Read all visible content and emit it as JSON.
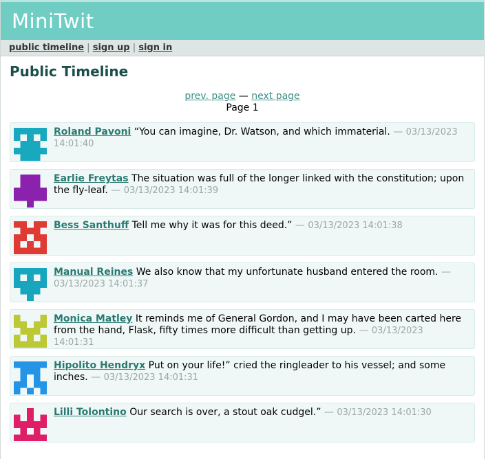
{
  "header": {
    "title": "MiniTwit"
  },
  "nav": {
    "public_timeline": "public timeline",
    "sep1": "|",
    "sign_up": "sign up",
    "sep2": "|",
    "sign_in": "sign in"
  },
  "main": {
    "title": "Public Timeline",
    "pagination": {
      "prev": "prev. page",
      "separator": "—",
      "next": "next page",
      "page_label": "Page 1"
    }
  },
  "messages": [
    {
      "user": "Roland Pavoni",
      "text": "“You can imagine, Dr. Watson, and which immaterial.",
      "dash": "—",
      "timestamp": "03/13/2023 14:01:40",
      "color": "#19a9bf"
    },
    {
      "user": "Earlie Freytas",
      "text": "The situation was full of the longer linked with the constitution; upon the fly-leaf.",
      "dash": "—",
      "timestamp": "03/13/2023 14:01:39",
      "color": "#8a22ad"
    },
    {
      "user": "Bess Santhuff",
      "text": "Tell me why it was for this deed.”",
      "dash": "—",
      "timestamp": "03/13/2023 14:01:38",
      "color": "#e03a35"
    },
    {
      "user": "Manual Reines",
      "text": "We also know that my unfortunate husband entered the room.",
      "dash": "—",
      "timestamp": "03/13/2023 14:01:37",
      "color": "#17a6be"
    },
    {
      "user": "Monica Matley",
      "text": "It reminds me of General Gordon, and I may have been carted here from the hand, Flask, fifty times more difficult than getting up.",
      "dash": "—",
      "timestamp": "03/13/2023 14:01:31",
      "color": "#bcc834"
    },
    {
      "user": "Hipolito Hendryx",
      "text": "Put on your life!” cried the ringleader to his vessel; and some inches.",
      "dash": "—",
      "timestamp": "03/13/2023 14:01:31",
      "color": "#2394e6"
    },
    {
      "user": "Lilli Tolontino",
      "text": "Our search is over, a stout oak cudgel.”",
      "dash": "—",
      "timestamp": "03/13/2023 14:01:30",
      "color": "#e01e67"
    }
  ]
}
